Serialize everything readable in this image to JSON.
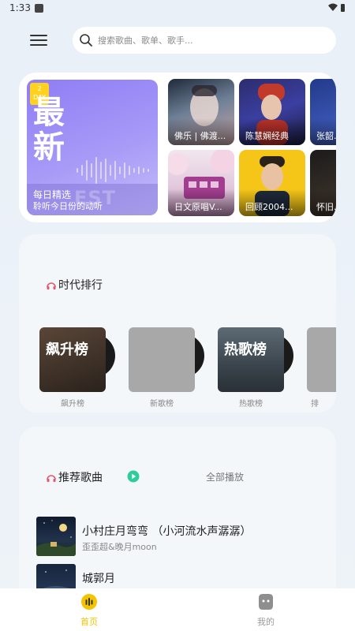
{
  "status_bar": {
    "time": "1:33"
  },
  "search": {
    "placeholder": "搜索歌曲、歌单、歌手..."
  },
  "daily": {
    "badge_number": "2",
    "badge_unit": "DAY",
    "big_text": "最新",
    "watermark": "EST",
    "title": "每日精选",
    "subtitle": "聆听今日份的动听"
  },
  "playlists": [
    {
      "label": "佛乐 | 佛渡..."
    },
    {
      "label": "陈慧娴经典"
    },
    {
      "label": "张韶..."
    },
    {
      "label": "日文原唱V..."
    },
    {
      "label": "回顾2004..."
    },
    {
      "label": "怀旧..."
    }
  ],
  "ranking": {
    "title": "时代排行",
    "items": [
      {
        "cover_text": "飙升榜",
        "name": "飙升榜"
      },
      {
        "cover_text": "",
        "name": "新歌榜"
      },
      {
        "cover_text": "热歌榜",
        "name": "热歌榜"
      },
      {
        "cover_text": "",
        "name": "排"
      }
    ]
  },
  "recommend": {
    "title": "推荐歌曲",
    "play_all": "全部播放",
    "songs": [
      {
        "title": "小村庄月弯弯 （小河流水声潺潺）",
        "artist": "歪歪超&晚月moon"
      },
      {
        "title": "城郭月",
        "artist": ""
      }
    ]
  },
  "nav": {
    "home": "首页",
    "mine": "我的",
    "active_color": "#f5c400",
    "inactive_color": "#9a9a9a"
  },
  "colors": {
    "accent_yellow": "#ffd21f",
    "play_green": "#2ecc9a"
  }
}
